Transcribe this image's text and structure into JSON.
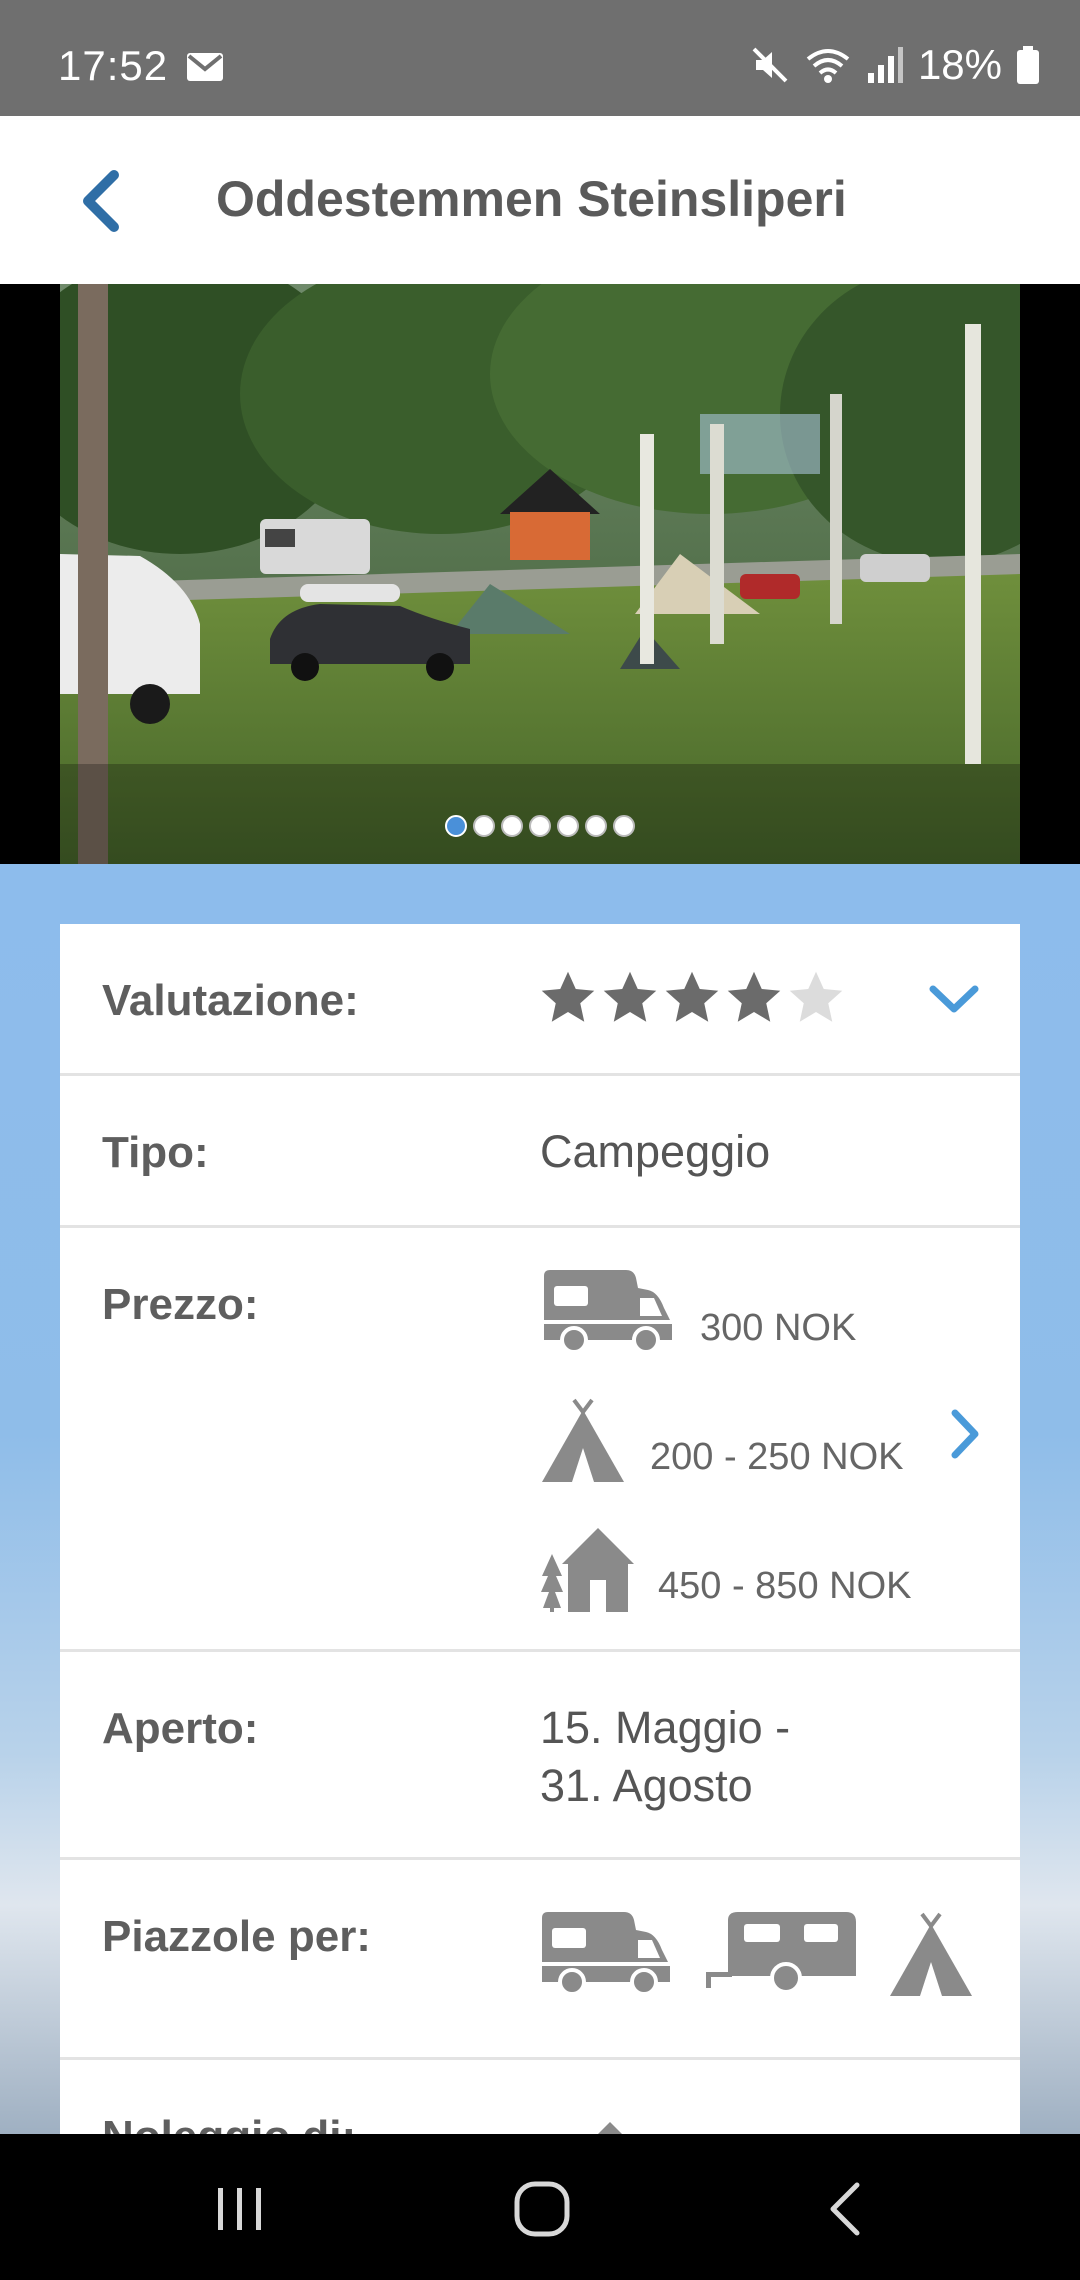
{
  "status_bar": {
    "time": "17:52",
    "battery_pct": "18%",
    "icons": [
      "mail-icon",
      "mute-icon",
      "wifi-icon",
      "signal-icon",
      "battery-icon"
    ]
  },
  "app_bar": {
    "title": "Oddestemmen Steinsliperi",
    "back_icon": "back-arrow-icon"
  },
  "carousel": {
    "photo_count": 7,
    "active_index": 0
  },
  "details": {
    "rating": {
      "label": "Valutazione:",
      "value": 4,
      "max": 5,
      "expand_icon": "chevron-down-icon"
    },
    "type": {
      "label": "Tipo:",
      "value": "Campeggio"
    },
    "price": {
      "label": "Prezzo:",
      "lines": [
        {
          "icon": "camper-icon",
          "text": "300 NOK"
        },
        {
          "icon": "tent-icon",
          "text": "200 - 250 NOK"
        },
        {
          "icon": "cabin-icon",
          "text": "450 - 850 NOK"
        }
      ],
      "more_icon": "chevron-right-icon"
    },
    "open": {
      "label": "Aperto:",
      "line1": "15. Maggio -",
      "line2": "31. Agosto"
    },
    "pitches": {
      "label": "Piazzole per:",
      "icons": [
        "camper-icon",
        "caravan-icon",
        "tent-icon"
      ]
    },
    "rental": {
      "label": "Noleggio di:"
    }
  },
  "colors": {
    "accent": "#4a9ad9",
    "status_bar": "#6f6f6f",
    "icon_gray": "#8a8a8a",
    "star_filled": "#6b6b6b",
    "star_empty": "#dcdcdc"
  },
  "nav_bar": {
    "icons": [
      "recent-apps-icon",
      "home-icon",
      "back-icon"
    ]
  }
}
